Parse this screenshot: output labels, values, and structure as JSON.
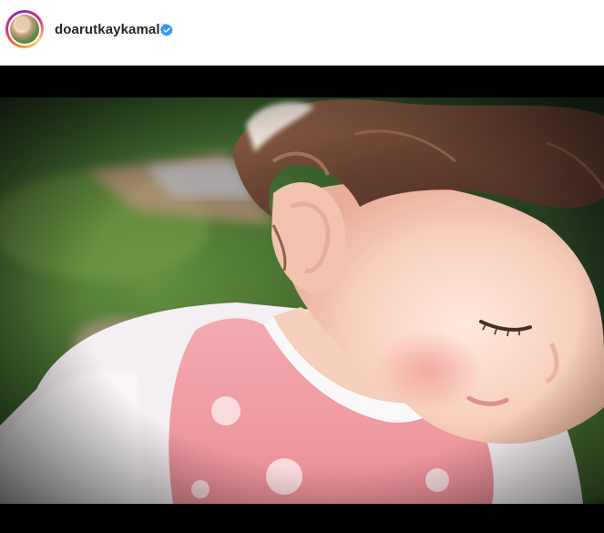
{
  "post": {
    "username": "doarutkaykamal",
    "verified": true,
    "media_description_icon": "photo-toddler",
    "colors": {
      "verified_badge": "#3897f0",
      "letterbox": "#000000",
      "avatar_ring": "#dd2a7b"
    }
  }
}
